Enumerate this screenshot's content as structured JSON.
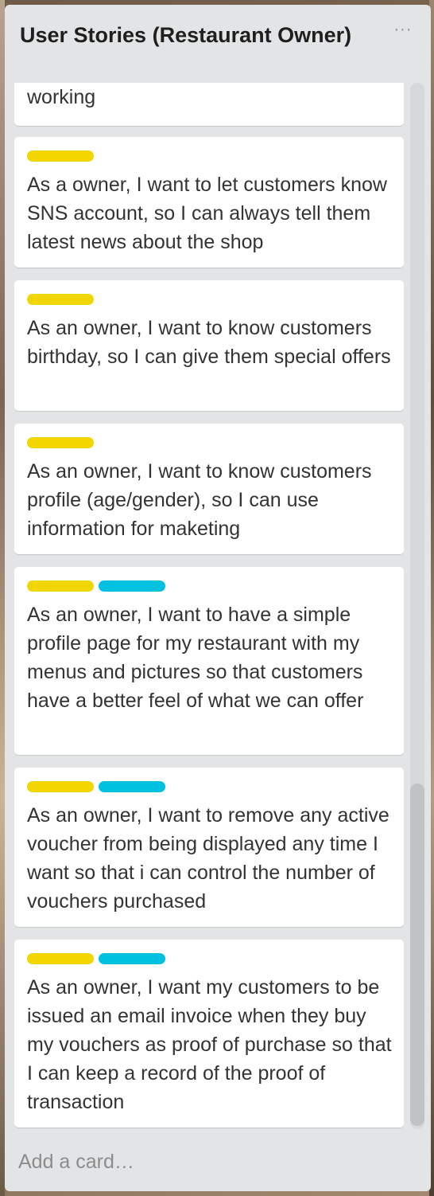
{
  "list": {
    "title": "User Stories (Restaurant Owner)",
    "menu_icon": "more-horizontal-icon",
    "menu_glyph": "···",
    "add_card_label": "Add a card…"
  },
  "colors": {
    "yellow_label": "#f2d600",
    "blue_label": "#00c2e0",
    "list_background": "#e2e4e6",
    "card_background": "#ffffff"
  },
  "cards": [
    {
      "text": "working",
      "labels": []
    },
    {
      "text": "As a owner, I want to let customers know SNS account, so I can always tell them latest news about the shop",
      "labels": [
        "yellow"
      ]
    },
    {
      "text": "As an owner, I want to know customers birthday, so I can give them special offers",
      "labels": [
        "yellow"
      ]
    },
    {
      "text": "As an owner, I want to know customers profile (age/gender), so I can use information for maketing",
      "labels": [
        "yellow"
      ]
    },
    {
      "text": "As an owner, I want to have a simple profile page for my restaurant with my menus and pictures so that customers have a better feel of what we can offer",
      "labels": [
        "yellow",
        "blue"
      ]
    },
    {
      "text": "As an owner, I want to remove any active voucher from being displayed any time I want so that i can control the number of vouchers purchased",
      "labels": [
        "yellow",
        "blue"
      ]
    },
    {
      "text": "As an owner, I want my customers to be issued an email invoice when they buy my vouchers as proof of purchase so that I can keep a record of the proof of transaction",
      "labels": [
        "yellow",
        "blue"
      ]
    }
  ]
}
